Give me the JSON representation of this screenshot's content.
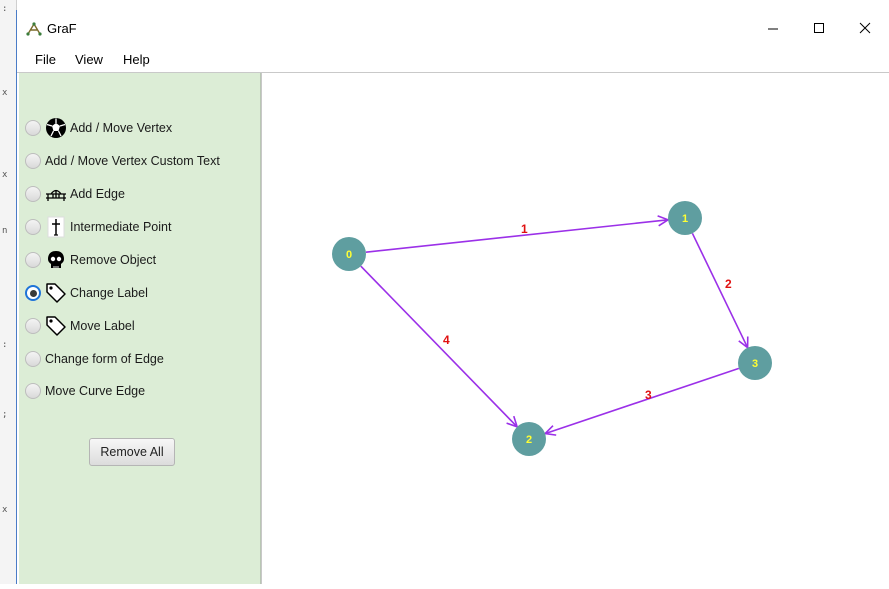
{
  "window": {
    "title": "GraF"
  },
  "menubar": {
    "items": [
      "File",
      "View",
      "Help"
    ]
  },
  "sidebar": {
    "options": [
      {
        "label": "Add / Move Vertex",
        "icon": "soccer-ball-icon",
        "selected": false
      },
      {
        "label": "Add / Move Vertex Custom Text",
        "icon": "",
        "selected": false
      },
      {
        "label": "Add Edge",
        "icon": "bridge-icon",
        "selected": false
      },
      {
        "label": "Intermediate Point",
        "icon": "cross-icon",
        "selected": false
      },
      {
        "label": "Remove Object",
        "icon": "skull-icon",
        "selected": false
      },
      {
        "label": "Change Label",
        "icon": "tag-icon",
        "selected": true
      },
      {
        "label": "Move Label",
        "icon": "tag-icon",
        "selected": false
      },
      {
        "label": "Change form of Edge",
        "icon": "",
        "selected": false
      },
      {
        "label": "Move Curve Edge",
        "icon": "",
        "selected": false
      }
    ],
    "remove_all_label": "Remove All"
  },
  "graph": {
    "vertices": [
      {
        "label": "0"
      },
      {
        "label": "1"
      },
      {
        "label": "2"
      },
      {
        "label": "3"
      }
    ],
    "edges": [
      {
        "from": "0",
        "to": "1",
        "label": "1"
      },
      {
        "from": "1",
        "to": "3",
        "label": "2"
      },
      {
        "from": "3",
        "to": "2",
        "label": "3"
      },
      {
        "from": "0",
        "to": "2",
        "label": "4"
      }
    ],
    "colors": {
      "vertex": "#5f9ea0",
      "vertex_label": "#ffff33",
      "edge": "#9b30e8",
      "edge_label": "#e01010"
    }
  }
}
